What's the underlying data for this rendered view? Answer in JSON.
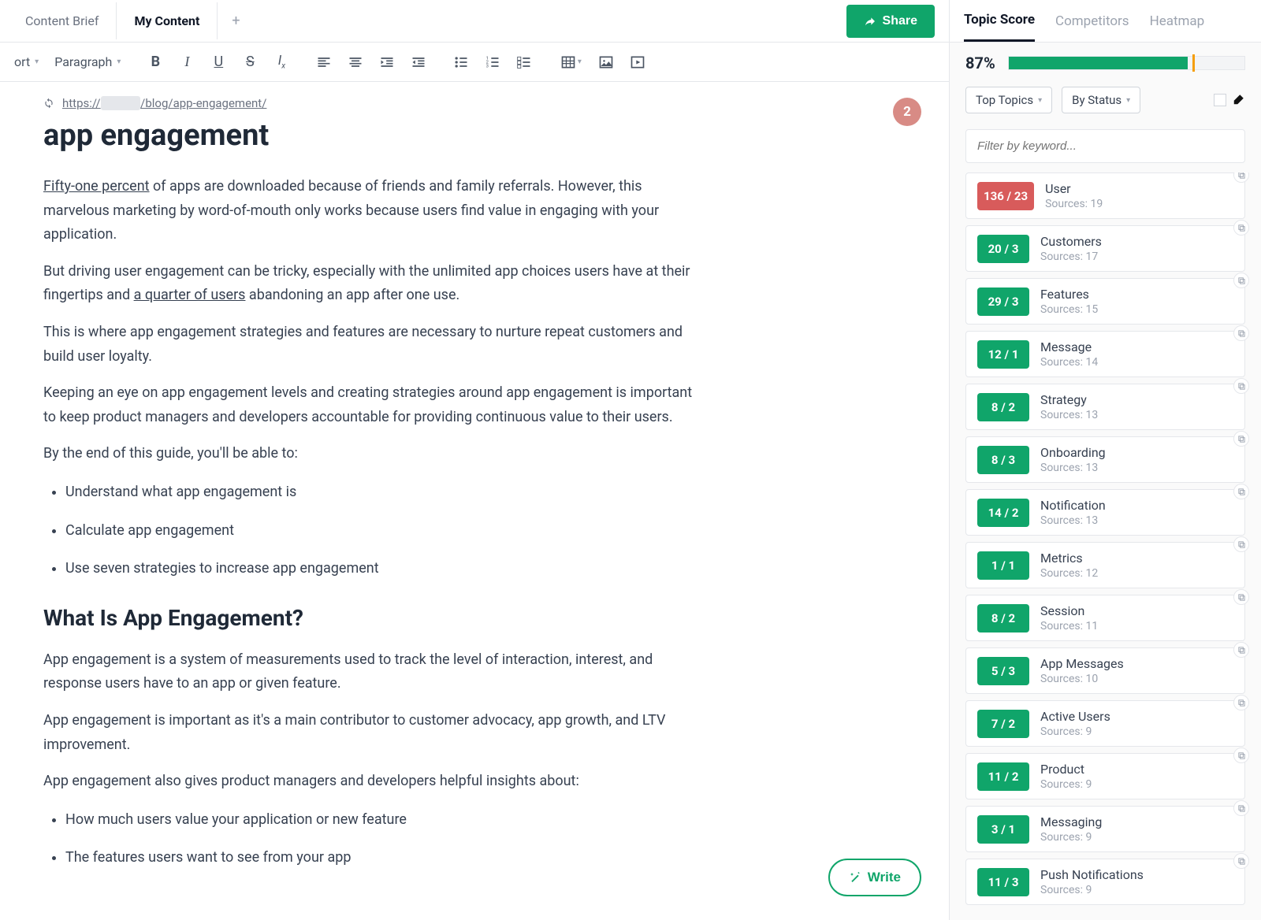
{
  "tabs": {
    "brief": "Content Brief",
    "mycontent": "My Content"
  },
  "share": "Share",
  "toolbar": {
    "format1": "ort",
    "format2": "Paragraph"
  },
  "url": {
    "prefix": "https://",
    "hidden": "████",
    "suffix": "/blog/app-engagement/"
  },
  "title": "app engagement",
  "badge": "2",
  "content": {
    "p1a": "Fifty-one percent",
    "p1b": " of apps are downloaded because of friends and family referrals. However, this marvelous marketing by word-of-mouth only works because users find value in engaging with your application.",
    "p2a": "But driving user engagement can be tricky, especially with the unlimited app choices users have at their fingertips and ",
    "p2b": "a quarter of users",
    "p2c": " abandoning an app after one use.",
    "p3": "This is where app engagement strategies and features are necessary to nurture repeat customers and build user loyalty.",
    "p4": "Keeping an eye on app engagement levels and creating strategies around app engagement is important to keep product managers and developers accountable for providing continuous value to their users.",
    "p5": "By the end of this guide, you'll be able to:",
    "li1": "Understand what app engagement is",
    "li2": "Calculate app engagement",
    "li3": "Use seven strategies to increase app engagement",
    "h2a": "What Is App Engagement?",
    "p6": "App engagement is a system of measurements used to track the level of interaction, interest, and response users have to an app or given feature.",
    "p7": "App engagement is important as it's a main contributor to customer advocacy, app growth, and LTV improvement.",
    "p8": "App engagement also gives product managers and developers helpful insights about:",
    "li4": "How much users value your application or new feature",
    "li5": "The features users want to see from your app"
  },
  "write": "Write",
  "sidebar": {
    "tabs": {
      "score": "Topic Score",
      "comp": "Competitors",
      "heat": "Heatmap"
    },
    "pct": "87%",
    "fill": 76,
    "mark": 78,
    "filters": {
      "top": "Top Topics",
      "status": "By Status"
    },
    "search_ph": "Filter by keyword...",
    "src_prefix": "Sources: ",
    "topics": [
      {
        "badge": "136 / 23",
        "name": "User",
        "src": "19",
        "color": "red"
      },
      {
        "badge": "20 / 3",
        "name": "Customers",
        "src": "17",
        "color": "green"
      },
      {
        "badge": "29 / 3",
        "name": "Features",
        "src": "15",
        "color": "green"
      },
      {
        "badge": "12 / 1",
        "name": "Message",
        "src": "14",
        "color": "green"
      },
      {
        "badge": "8 / 2",
        "name": "Strategy",
        "src": "13",
        "color": "green"
      },
      {
        "badge": "8 / 3",
        "name": "Onboarding",
        "src": "13",
        "color": "green"
      },
      {
        "badge": "14 / 2",
        "name": "Notification",
        "src": "13",
        "color": "green"
      },
      {
        "badge": "1 / 1",
        "name": "Metrics",
        "src": "12",
        "color": "green"
      },
      {
        "badge": "8 / 2",
        "name": "Session",
        "src": "11",
        "color": "green"
      },
      {
        "badge": "5 / 3",
        "name": "App Messages",
        "src": "10",
        "color": "green"
      },
      {
        "badge": "7 / 2",
        "name": "Active Users",
        "src": "9",
        "color": "green"
      },
      {
        "badge": "11 / 2",
        "name": "Product",
        "src": "9",
        "color": "green"
      },
      {
        "badge": "3 / 1",
        "name": "Messaging",
        "src": "9",
        "color": "green"
      },
      {
        "badge": "11 / 3",
        "name": "Push Notifications",
        "src": "9",
        "color": "green"
      }
    ]
  }
}
